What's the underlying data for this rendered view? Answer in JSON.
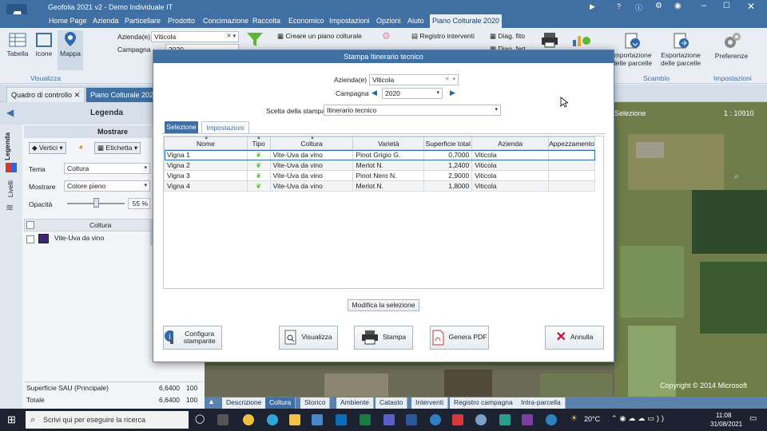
{
  "app": {
    "title": "Geofolia 2021 v2 - Demo Individuale IT"
  },
  "menu": [
    {
      "label": "Home Page"
    },
    {
      "label": "Azienda"
    },
    {
      "label": "Particellare"
    },
    {
      "label": "Prodotto"
    },
    {
      "label": "Concimazione"
    },
    {
      "label": "Raccolta"
    },
    {
      "label": "Economico"
    },
    {
      "label": "Impostazioni"
    },
    {
      "label": "Opzioni"
    },
    {
      "label": "Aiuto"
    },
    {
      "label": "Piano Colturale 2020"
    }
  ],
  "ribbon": {
    "tabella": "Tabella",
    "icone": "Icone",
    "mappa": "Mappa",
    "visualizza_group": "Visualizza",
    "azienda_label": "Azienda(e)",
    "azienda_value": "Viticola",
    "campagna_label": "Campagna",
    "campagna_value": "2020",
    "crea_piano": "Creare un piano colturale",
    "registro_interventi": "Registro interventi",
    "diag_fito": "Diag. fito",
    "diag_fert": "Diag. fert.",
    "importazione": "Importazione delle parcelle",
    "esportazione": "Esportazione delle parcelle",
    "scambio_group": "Scambio",
    "preferenze": "Preferenze",
    "impostazioni_group": "Impostazioni"
  },
  "doctabs": [
    {
      "label": "Quadro di controllo"
    },
    {
      "label": "Piano Colturale 2020"
    }
  ],
  "legend": {
    "title": "Legenda",
    "mostrare_title": "Mostrare",
    "vertici": "Vertici",
    "etichetta": "Etichetta",
    "tema_label": "Tema",
    "tema_value": "Coltura",
    "mostrare_label": "Mostrare",
    "mostrare_value": "Colore pieno",
    "opacita_label": "Opacità",
    "opacita_value": "55 %",
    "col_header": "Coltura",
    "row_item": "Vite-Uva da vino",
    "side_tabs": [
      "Legenda",
      "Livelli"
    ]
  },
  "summary": [
    {
      "label": "Superficie SAU (Principale)",
      "value": "6,6400",
      "pct": "100"
    },
    {
      "label": "Totale",
      "value": "6,6400",
      "pct": "100"
    }
  ],
  "map": {
    "selection_label": "Selezione",
    "scale": "1 : 10910",
    "copyright": "Copyright © 2014 Microsoft"
  },
  "bottom_tabs": [
    {
      "label": "Descrizione"
    },
    {
      "label": "Coltura"
    },
    {
      "label": "Storico"
    },
    {
      "label": "Ambiente"
    },
    {
      "label": "Catasto"
    },
    {
      "label": "Interventi"
    },
    {
      "label": "Registro campagna"
    },
    {
      "label": "Intra-parcella"
    }
  ],
  "dialog": {
    "title": "Stampa Itinerario tecnico",
    "azienda_label": "Azienda(e)",
    "azienda_value": "Viticola",
    "campagna_label": "Campagna",
    "campagna_value": "2020",
    "scelta_label": "Scelta della stampa",
    "scelta_value": "Itinerario tecnico",
    "tabs": [
      {
        "label": "Selezione"
      },
      {
        "label": "Impostazioni"
      }
    ],
    "columns": [
      "Nome",
      "Tipo",
      "Coltura",
      "Varietà",
      "Superficie total",
      "Azienda",
      "Appezzamento"
    ],
    "rows": [
      {
        "nome": "Vigna 1",
        "coltura": "Vite-Uva da vino",
        "varieta": "Pinot Grigio G.",
        "superficie": "0,7000",
        "azienda": "Viticola",
        "appezzamento": ""
      },
      {
        "nome": "Vigna 2",
        "coltura": "Vite-Uva da vino",
        "varieta": "Merlot N.",
        "superficie": "1,2400",
        "azienda": "Viticola",
        "appezzamento": ""
      },
      {
        "nome": "Vigna 3",
        "coltura": "Vite-Uva da vino",
        "varieta": "Pinot Nero N.",
        "superficie": "2,9000",
        "azienda": "Viticola",
        "appezzamento": ""
      },
      {
        "nome": "Vigna 4",
        "coltura": "Vite-Uva da vino",
        "varieta": "Merlot N.",
        "superficie": "1,8000",
        "azienda": "Viticola",
        "appezzamento": ""
      }
    ],
    "modifica": "Modifica la selezione",
    "configura": "Configura stampante",
    "visualizza": "Visualizza",
    "stampa": "Stampa",
    "genera_pdf": "Genera PDF",
    "annulla": "Annulla"
  },
  "taskbar": {
    "search_placeholder": "Scrivi qui per eseguire la ricerca",
    "weather": "20°C",
    "time": "11:08",
    "date": "31/08/2021"
  }
}
